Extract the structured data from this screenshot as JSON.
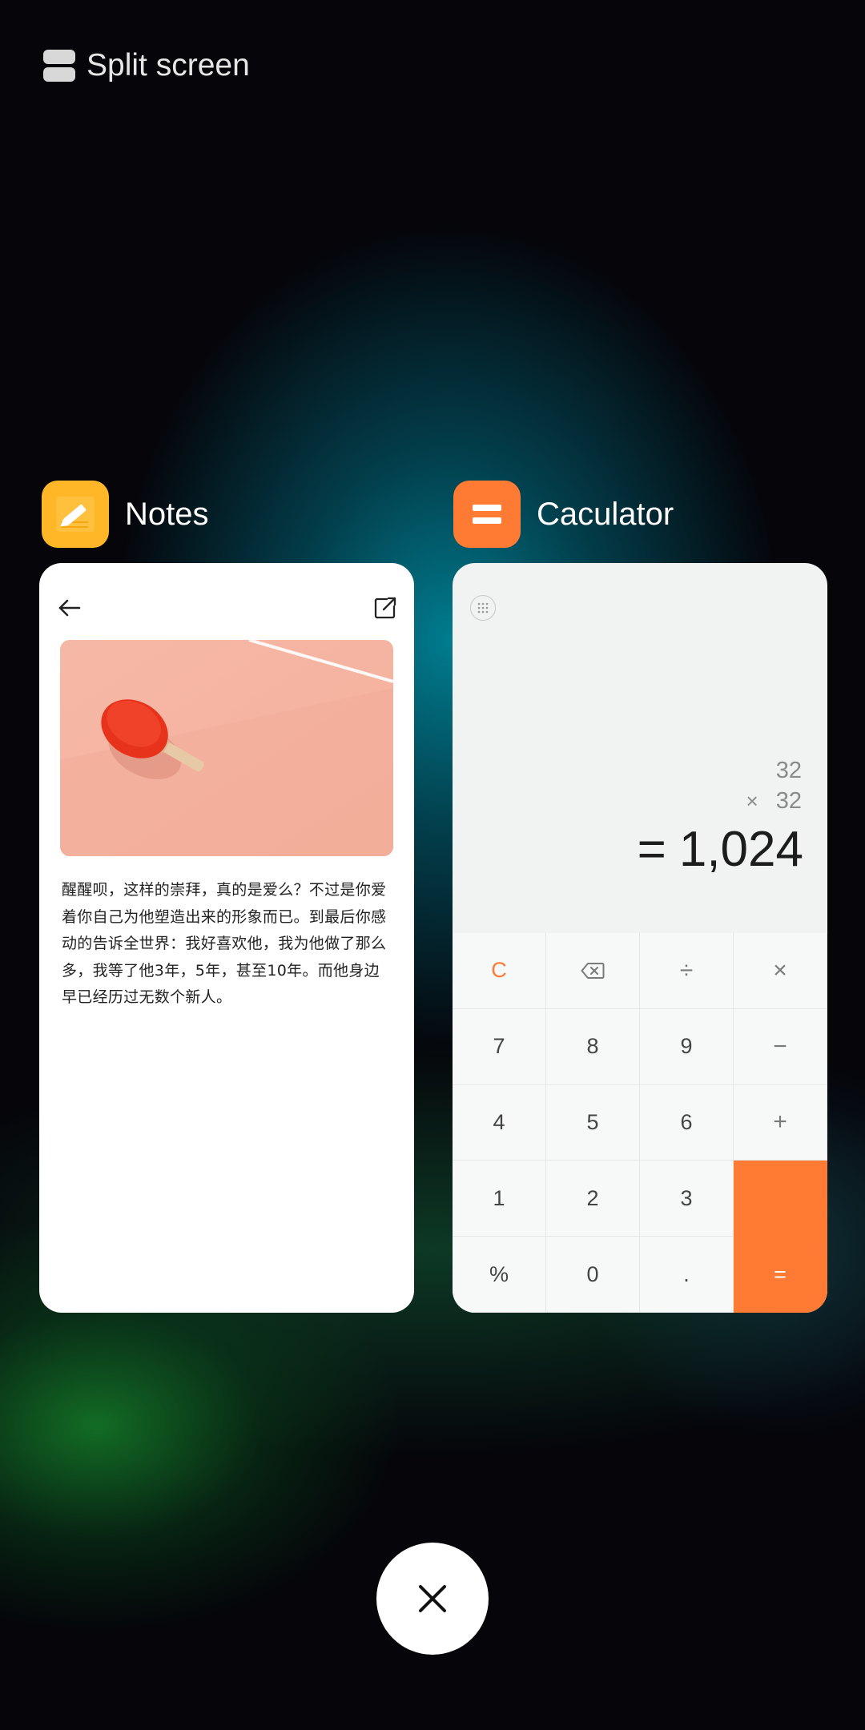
{
  "header": {
    "label": "Split screen",
    "icon": "split-screen-icon"
  },
  "apps": {
    "notes": {
      "title": "Notes",
      "icon": "pencil-icon",
      "icon_color": "#ffb727",
      "body_text": "醒醒呗，这样的崇拜，真的是爱么？不过是你爱着你自己为他塑造出来的形象而已。到最后你感动的告诉全世界：我好喜欢他，我为他做了那么多，我等了他3年，5年，甚至10年。而他身边早已经历过无数个新人。"
    },
    "calculator": {
      "title": "Caculator",
      "icon": "equals-icon",
      "icon_color": "#ff7a32",
      "expression": {
        "operand1": "32",
        "operator": "×",
        "operand2": "32"
      },
      "result": {
        "equals": "=",
        "value": "1,024"
      },
      "keys": [
        "C",
        "⌫",
        "÷",
        "×",
        "7",
        "8",
        "9",
        "−",
        "4",
        "5",
        "6",
        "+",
        "1",
        "2",
        "3",
        "",
        "%",
        "0",
        ".",
        "="
      ]
    }
  },
  "close_button": {
    "icon": "close-icon"
  }
}
